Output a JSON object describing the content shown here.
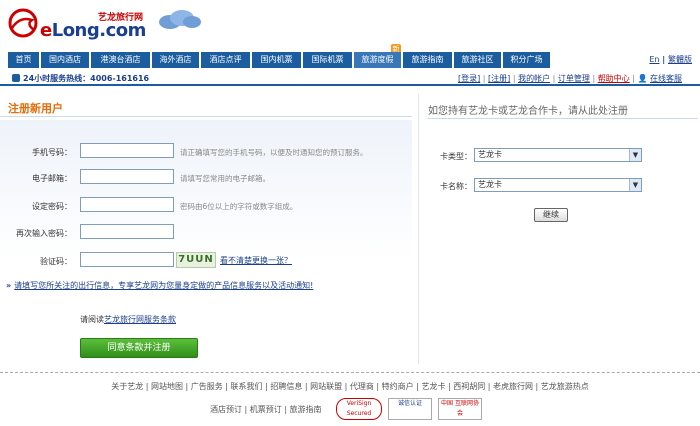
{
  "header": {
    "logo_cn": "艺龙旅行网",
    "logo_en_prefix": "e",
    "logo_en_rest": "Long.com",
    "lang_en": "En",
    "lang_sep": " | ",
    "lang_tw": "繁體版"
  },
  "nav": {
    "items": [
      "首页",
      "国内酒店",
      "港澳台酒店",
      "海外酒店",
      "酒店点评",
      "国内机票",
      "国际机票",
      "旅游度假",
      "旅游指南",
      "旅游社区",
      "积分广场"
    ],
    "new_badge": "新"
  },
  "subbar": {
    "hotline": "24小时服务热线：4006-161616",
    "links": [
      "[登录]",
      "[注册]",
      "我的帐户",
      "订单管理",
      "帮助中心",
      "在线客服"
    ]
  },
  "register": {
    "title": "注册新用户",
    "fields": [
      {
        "label": "手机号码：",
        "value": "",
        "hint": "请正确填写您的手机号码，以便及时通知您的预订服务。"
      },
      {
        "label": "电子邮箱：",
        "value": "",
        "hint": "请填写您常用的电子邮箱。"
      },
      {
        "label": "设定密码：",
        "value": "",
        "hint": "密码由6位以上的字符或数字组成。"
      },
      {
        "label": "再次输入密码：",
        "value": "",
        "hint": ""
      },
      {
        "label": "验证码：",
        "value": "",
        "hint": ""
      }
    ],
    "captcha_text": "7UUN",
    "captcha_link": "看不清楚更换一张？",
    "notice": "请填写您所关注的出行信息，专享艺龙网为您量身定做的产品信息服务以及活动通知!",
    "terms_prefix": "请阅读",
    "terms_link": "艺龙旅行网服务条款",
    "submit": "同意条款并注册"
  },
  "card": {
    "title": "如您持有艺龙卡或艺龙合作卡，请从此处注册",
    "type_label": "卡类型：",
    "type_value": "艺龙卡",
    "name_label": "卡名称：",
    "name_value": "艺龙卡",
    "continue": "继续"
  },
  "footer": {
    "links": "关于艺龙 | 网站地图 | 广告服务 | 联系我们 | 招聘信息 | 网站联盟 | 代理商 | 特约商户 | 艺龙卡 | 西祠胡同 | 老虎旅行网 | 艺龙旅游热点",
    "links2": "酒店预订 | 机票预订 | 旅游指南",
    "badges": [
      "VeriSign Secured",
      "诚信认证",
      "中国 互联网协会"
    ]
  }
}
